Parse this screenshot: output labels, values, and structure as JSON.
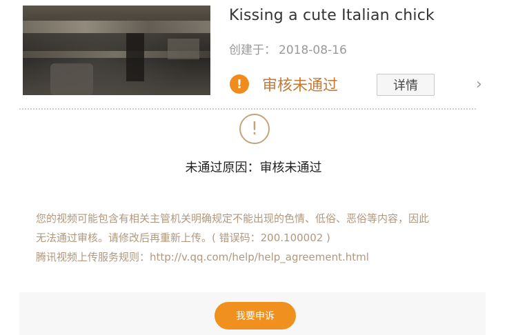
{
  "video": {
    "title": "Kissing a cute Italian chick",
    "created_label": "创建于：",
    "created_date": "2018-08-16",
    "status_icon_glyph": "!",
    "status_text": "审核未通过",
    "detail_button": "详情",
    "chevron": "›"
  },
  "rejection": {
    "icon_glyph": "!",
    "reason_label": "未通过原因：",
    "reason_value": "审核未通过",
    "description_line1": "您的视频可能包含有相关主管机关明确规定不能出现的色情、低俗、恶俗等内容，因此",
    "description_line2": "无法通过审核。请修改后再重新上传。( 错误码：200.100002 )",
    "rules_label": "腾讯视频上传服务规则：",
    "rules_link": "http://v.qq.com/help/help_agreement.html"
  },
  "actions": {
    "appeal_button": "我要申诉"
  },
  "colors": {
    "accent": "#f0901e",
    "status_text": "#c67a34",
    "muted": "#999999",
    "description": "#b0987e"
  },
  "icons": {
    "status": "exclamation-circle-icon",
    "rejection": "warning-circle-icon",
    "next": "chevron-right-icon"
  }
}
